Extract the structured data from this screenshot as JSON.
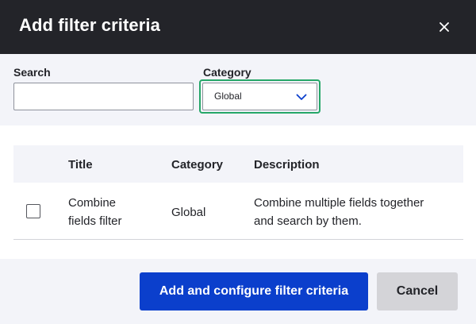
{
  "dialog": {
    "title": "Add filter criteria",
    "close_icon": "close-icon"
  },
  "filters": {
    "search_label": "Search",
    "search_value": "",
    "category_label": "Category",
    "category_selected": "Global",
    "dropdown_icon": "chevron-down-icon"
  },
  "table": {
    "headers": {
      "title": "Title",
      "category": "Category",
      "description": "Description"
    },
    "rows": [
      {
        "checked": false,
        "title_line1": "Combine",
        "title_line2": "fields filter",
        "category": "Global",
        "description_line1": "Combine multiple fields together",
        "description_line2": "and search by them."
      }
    ]
  },
  "footer": {
    "primary_label": "Add and configure filter criteria",
    "cancel_label": "Cancel"
  },
  "colors": {
    "titlebar": "#232429",
    "primary": "#0b3fcc",
    "focus": "#26a769",
    "secondary": "#d4d4d8"
  }
}
